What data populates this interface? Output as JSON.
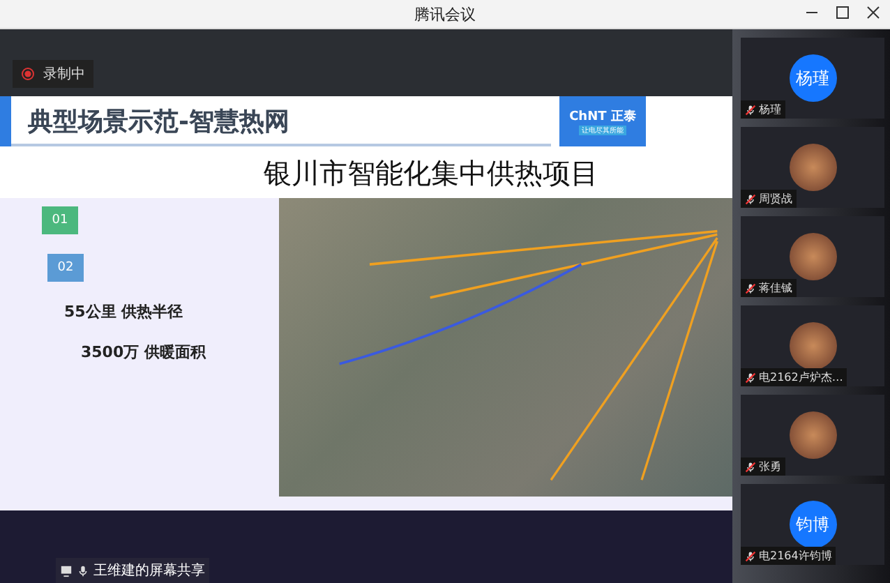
{
  "window": {
    "title": "腾讯会议"
  },
  "recording": {
    "label": "录制中"
  },
  "slide": {
    "title": "典型场景示范-智慧热网",
    "logo": {
      "brand": "ChNT 正泰",
      "slogan": "让电尽其所能"
    },
    "subtitle": "银川市智能化集中供热项目",
    "tags": [
      {
        "label": "01",
        "color": "#4cb87e"
      },
      {
        "label": "02",
        "color": "#5b9bd5"
      }
    ],
    "stats": [
      "55公里 供热半径",
      "3500万 供暖面积"
    ]
  },
  "share_label": "王维建的屏幕共享",
  "participants": [
    {
      "name": "杨瑾",
      "kind": "initials",
      "avatar_text": "杨瑾",
      "muted": true
    },
    {
      "name": "周贤战",
      "kind": "photo",
      "muted": true
    },
    {
      "name": "蒋佳铖",
      "kind": "photo",
      "muted": true
    },
    {
      "name": "电2162卢炉杰…",
      "kind": "photo",
      "muted": true
    },
    {
      "name": "张勇",
      "kind": "photo",
      "muted": true
    },
    {
      "name": "电2164许钧博",
      "kind": "initials",
      "avatar_text": "钧博",
      "muted": true
    }
  ]
}
